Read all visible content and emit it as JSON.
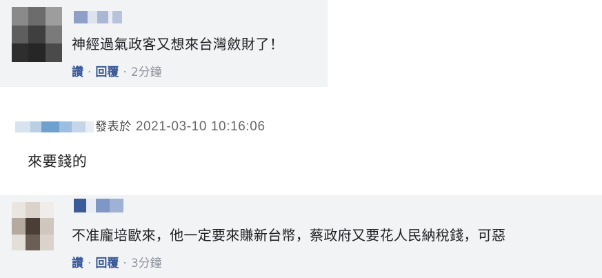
{
  "comments": [
    {
      "text": "神經過氣政客又想來台灣斂財了！",
      "actions": {
        "reply_like": "讚",
        "separator": "·",
        "reply": "回覆",
        "time": "2分鐘"
      }
    },
    {
      "posted_label": "發表於",
      "datetime": "2021-03-10 10:16:06",
      "text": "來要錢的"
    },
    {
      "text": "不准龐培歐來，他一定要來賺新台幣，蔡政府又要花人民納稅錢，可惡",
      "actions": {
        "reply_like": "讚",
        "separator": "·",
        "reply": "回覆",
        "time": "3分鐘"
      }
    }
  ],
  "colors": {
    "card_background": "#f2f3f5",
    "link": "#385898",
    "meta_text": "#90949c"
  }
}
